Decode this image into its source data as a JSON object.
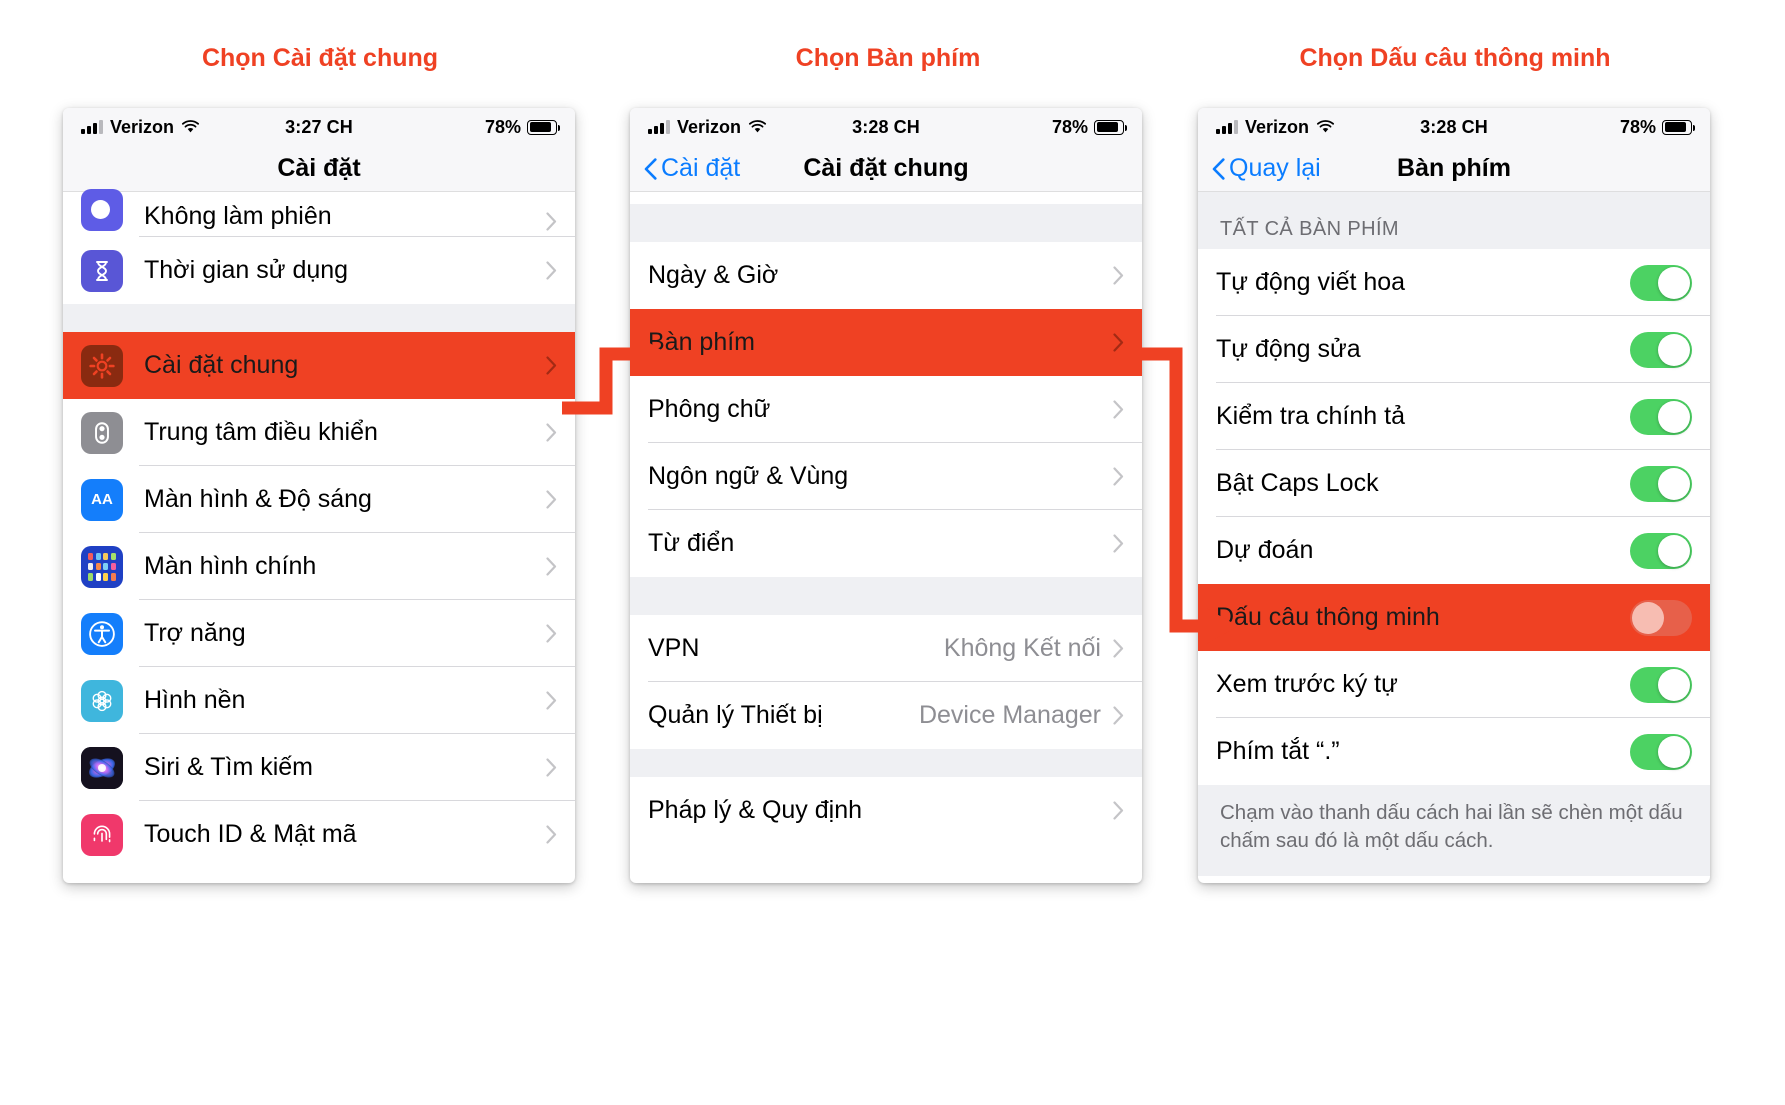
{
  "captions": {
    "step1": "Chọn Cài đặt chung",
    "step2": "Chọn Bàn phím",
    "step3": "Chọn Dấu câu thông minh"
  },
  "colors": {
    "accent": "#ef4123",
    "link": "#0a7cff",
    "toggle_on": "#4cd263",
    "toggle_off_track": "#e7604a",
    "group_bg": "#eff0f3"
  },
  "phone1": {
    "status": {
      "carrier": "Verizon",
      "time": "3:27 CH",
      "battery": "78%"
    },
    "nav": {
      "title": "Cài đặt",
      "back": ""
    },
    "rows": [
      {
        "label": "Không làm phiên",
        "icon": "moon-icon",
        "accessory": "chevron"
      },
      {
        "label": "Thời gian sử dụng",
        "icon": "hourglass-icon",
        "accessory": "chevron"
      },
      {
        "label": "Cài đặt chung",
        "icon": "gear-icon",
        "accessory": "chevron",
        "highlight": true
      },
      {
        "label": "Trung tâm điều khiển",
        "icon": "control-center-icon",
        "accessory": "chevron"
      },
      {
        "label": "Màn hình & Độ sáng",
        "icon": "display-aa-icon",
        "accessory": "chevron"
      },
      {
        "label": "Màn hình chính",
        "icon": "home-screen-icon",
        "accessory": "chevron"
      },
      {
        "label": "Trợ năng",
        "icon": "accessibility-icon",
        "accessory": "chevron"
      },
      {
        "label": "Hình nền",
        "icon": "wallpaper-icon",
        "accessory": "chevron"
      },
      {
        "label": "Siri & Tìm kiếm",
        "icon": "siri-icon",
        "accessory": "chevron"
      },
      {
        "label": "Touch ID & Mật mã",
        "icon": "touch-id-icon",
        "accessory": "chevron"
      }
    ]
  },
  "phone2": {
    "status": {
      "carrier": "Verizon",
      "time": "3:28 CH",
      "battery": "78%"
    },
    "nav": {
      "title": "Cài đặt chung",
      "back": "Cài đặt"
    },
    "group1": [
      {
        "label": "Ngày & Giờ",
        "accessory": "chevron"
      },
      {
        "label": "Bàn phím",
        "accessory": "chevron",
        "highlight": true
      },
      {
        "label": "Phông chữ",
        "accessory": "chevron"
      },
      {
        "label": "Ngôn ngữ & Vùng",
        "accessory": "chevron"
      },
      {
        "label": "Từ điển",
        "accessory": "chevron"
      }
    ],
    "group2": [
      {
        "label": "VPN",
        "value": "Không Kết nối",
        "accessory": "chevron"
      },
      {
        "label": "Quản lý Thiết bị",
        "value": "Device Manager",
        "accessory": "chevron"
      }
    ],
    "group3": [
      {
        "label": "Pháp lý & Quy định",
        "accessory": "chevron"
      }
    ]
  },
  "phone3": {
    "status": {
      "carrier": "Verizon",
      "time": "3:28 CH",
      "battery": "78%"
    },
    "nav": {
      "title": "Bàn phím",
      "back": "Quay lại"
    },
    "section_header": "TẤT CẢ BÀN PHÍM",
    "rows": [
      {
        "label": "Tự động viết hoa",
        "toggle": "on"
      },
      {
        "label": "Tự động sửa",
        "toggle": "on"
      },
      {
        "label": "Kiểm tra chính tả",
        "toggle": "on"
      },
      {
        "label": "Bật Caps Lock",
        "toggle": "on"
      },
      {
        "label": "Dự đoán",
        "toggle": "on"
      },
      {
        "label": "Dấu câu thông minh",
        "toggle": "off",
        "highlight": true
      },
      {
        "label": "Xem trước ký tự",
        "toggle": "on"
      },
      {
        "label": "Phím tắt “.”",
        "toggle": "on"
      }
    ],
    "footnote": "Chạm vào thanh dấu cách hai lần sẽ chèn một dấu chấm sau đó là một dấu cách."
  }
}
